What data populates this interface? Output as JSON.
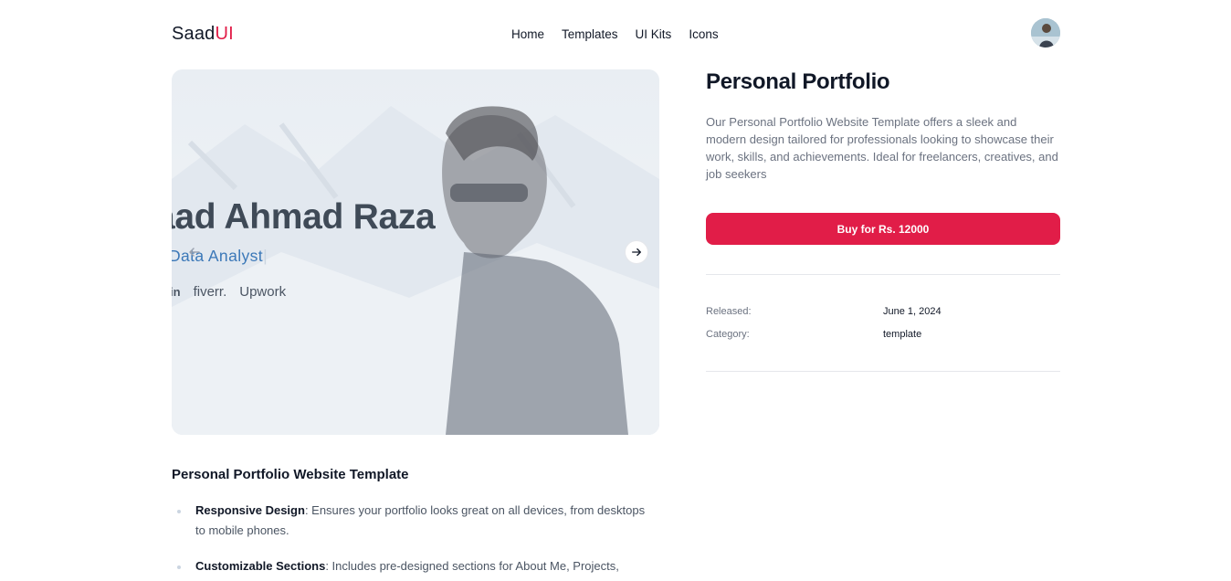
{
  "header": {
    "logo_main": "Saad",
    "logo_accent": "UI",
    "nav": [
      "Home",
      "Templates",
      "UI Kits",
      "Icons"
    ]
  },
  "hero": {
    "name": "aad Ahmad Raza",
    "role": "Data Analyst",
    "role_cursor": "|",
    "socials": [
      "in",
      "fiverr.",
      "Upwork"
    ]
  },
  "product": {
    "title": "Personal Portfolio",
    "description": "Our Personal Portfolio Website Template offers a sleek and modern design tailored for professionals looking to showcase their work, skills, and achievements. Ideal for freelancers, creatives, and job seekers",
    "buy_label": "Buy for Rs. 12000",
    "meta": [
      {
        "label": "Released:",
        "value": "June 1, 2024"
      },
      {
        "label": "Category:",
        "value": "template"
      }
    ]
  },
  "details": {
    "title": "Personal Portfolio Website Template",
    "features": [
      {
        "title": "Responsive Design",
        "text": ": Ensures your portfolio looks great on all devices, from desktops to mobile phones."
      },
      {
        "title": "Customizable Sections",
        "text": ": Includes pre-designed sections for About Me, Projects,"
      }
    ]
  },
  "colors": {
    "accent": "#e11d48",
    "role_text": "#3b78b8"
  }
}
